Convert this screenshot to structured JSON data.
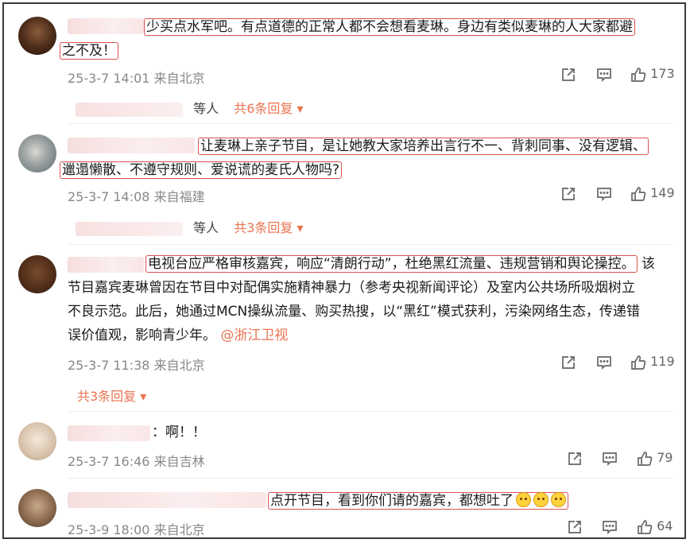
{
  "comments": [
    {
      "text_hl": "少买点水军吧。有点道德的正常人都不会想看麦琳。身边有类似麦琳的人大家都避",
      "text_hl2": "之不及！",
      "time": "25-3-7 14:01",
      "location": "来自北京",
      "likes": "173",
      "reply_deng": "等人",
      "reply_more": "共6条回复 ▾"
    },
    {
      "text_hl": "让麦琳上亲子节目，是让她教大家培养出言行不一、背刺同事、没有逻辑、",
      "text_hl2": "邋遢懒散、不遵守规则、爱说谎的麦氏人物吗?",
      "time": "25-3-7 14:08",
      "location": "来自福建",
      "likes": "149",
      "reply_deng": "等人",
      "reply_more": "共3条回复 ▾"
    },
    {
      "text_hl": "电视台应严格审核嘉宾，响应“清朗行动”，杜绝黑红流量、违规营销和舆论操控。",
      "text_tail": "该",
      "text_line2": "节目嘉宾麦琳曾因在节目中对配偶实施精神暴力（参考央视新闻评论）及室内公共场所吸烟树立",
      "text_line3": "不良示范。此后，她通过MCN操纵流量、购买热搜，以“黑红”模式获利，污染网络生态，传递错",
      "text_line4": "误价值观，影响青少年。",
      "mention": "@浙江卫视",
      "time": "25-3-7 11:38",
      "location": "来自北京",
      "likes": "119",
      "reply_more": "共3条回复 ▾"
    },
    {
      "text": "：啊！！",
      "time": "25-3-7 16:46",
      "location": "来自吉林",
      "likes": "79"
    },
    {
      "text_hl": "点开节目，看到你们请的嘉宾，都想吐了",
      "time": "25-3-9 18:00",
      "location": "来自北京",
      "likes": "64"
    }
  ],
  "icons": {
    "share": "share-icon",
    "comment": "comment-icon",
    "like": "like-icon",
    "emoji": "dog-emoji-icon"
  },
  "colors": {
    "highlight_border": "#d9534f",
    "link_orange": "#eb7350",
    "meta_gray": "#888888"
  }
}
